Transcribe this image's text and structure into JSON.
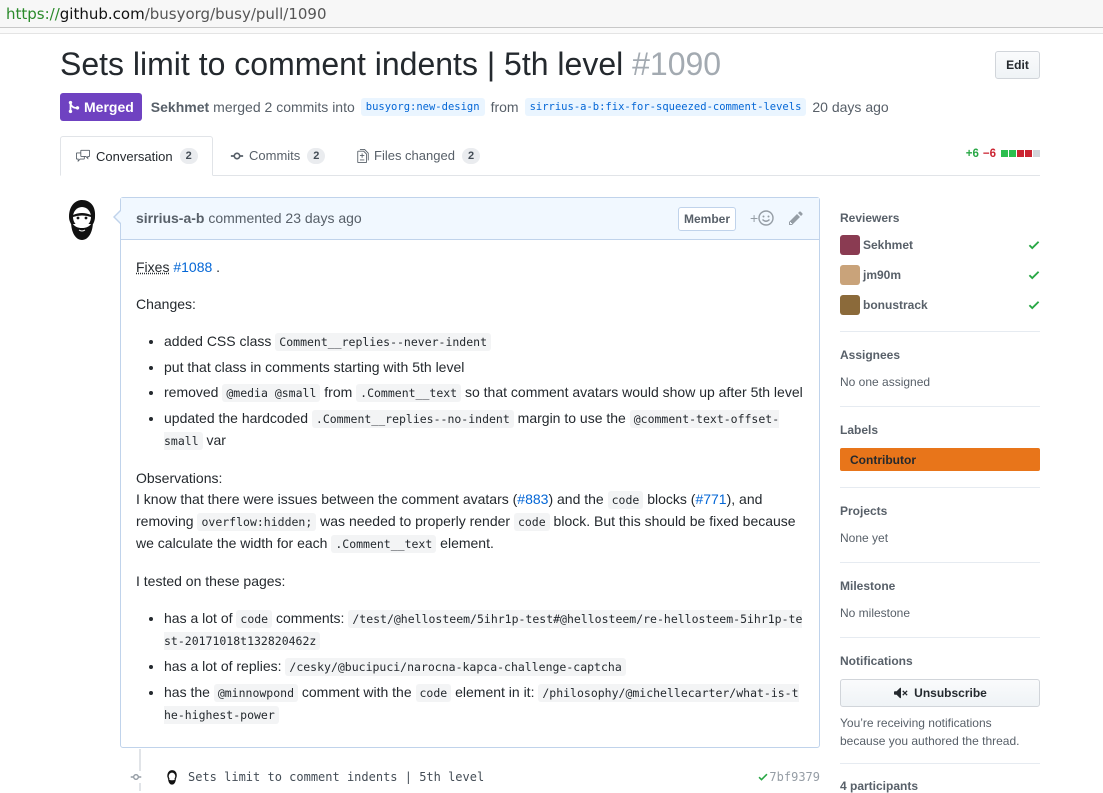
{
  "browser": {
    "url_scheme": "https://",
    "url_host": "github.com",
    "url_path": "/busyorg/busy/pull/1090"
  },
  "pr": {
    "title": "Sets limit to comment indents | 5th level",
    "number": "#1090",
    "edit_label": "Edit",
    "state": "Merged",
    "merged_by": "Sekhmet",
    "merge_text": "merged 2 commits into",
    "base_branch": "busyorg:new-design",
    "from_text": "from",
    "head_branch": "sirrius-a-b:fix-for-squeezed-comment-levels",
    "time": "20 days ago"
  },
  "tabs": [
    {
      "label": "Conversation",
      "count": "2"
    },
    {
      "label": "Commits",
      "count": "2"
    },
    {
      "label": "Files changed",
      "count": "2"
    }
  ],
  "diffstat": {
    "additions": "+6",
    "deletions": "−6",
    "colors": [
      "#2cbe4e",
      "#2cbe4e",
      "#cb2431",
      "#cb2431",
      "#d1d5da"
    ]
  },
  "comment": {
    "author": "sirrius-a-b",
    "action": "commented",
    "time": "23 days ago",
    "role": "Member",
    "reaction_plus": "+"
  },
  "body": {
    "fixes_prefix": "Fixes",
    "fixes_link": "#1088",
    "fixes_suffix": ".",
    "changes_heading": "Changes:",
    "c1_text": "added CSS class",
    "c1_code": "Comment__replies--never-indent",
    "c2_text": "put that class in comments starting with 5th level",
    "c3_a": "removed",
    "c3_code1": "@media @small",
    "c3_b": "from",
    "c3_code2": ".Comment__text",
    "c3_c": "so that comment avatars would show up after 5th level",
    "c4_a": "updated the hardcoded",
    "c4_code1": ".Comment__replies--no-indent",
    "c4_b": "margin to use the",
    "c4_code2": "@comment-text-offset-small",
    "c4_c": "var",
    "obs_heading": "Observations:",
    "obs_a": "I know that there were issues between the comment avatars (",
    "obs_link1": "#883",
    "obs_b": ") and the",
    "obs_code1": "code",
    "obs_c": "blocks (",
    "obs_link2": "#771",
    "obs_d": "), and removing",
    "obs_code2": "overflow:hidden;",
    "obs_e": "was needed to properly render",
    "obs_code3": "code",
    "obs_f": "block. But this should be fixed because we calculate the width for each",
    "obs_code4": ".Comment__text",
    "obs_g": "element.",
    "tested_heading": "I tested on these pages:",
    "t1_a": "has a lot of",
    "t1_code1": "code",
    "t1_b": "comments:",
    "t1_code2": "/test/@hellosteem/5ihr1p-test#@hellosteem/re-hellosteem-5ihr1p-test-20171018t132820462z",
    "t2_a": "has a lot of replies:",
    "t2_code": "/cesky/@bucipuci/narocna-kapca-challenge-captcha",
    "t3_a": "has the",
    "t3_code1": "@minnowpond",
    "t3_b": "comment with the",
    "t3_code2": "code",
    "t3_c": "element in it:",
    "t3_code3": "/philosophy/@michellecarter/what-is-the-highest-power"
  },
  "commit": {
    "message": "Sets limit to comment indents | 5th level",
    "sha": "7bf9379"
  },
  "sidebar": {
    "reviewers_heading": "Reviewers",
    "reviewers": [
      {
        "name": "Sekhmet",
        "color": "#8a3b52"
      },
      {
        "name": "jm90m",
        "color": "#c9a37a"
      },
      {
        "name": "bonustrack",
        "color": "#8b6a3a"
      }
    ],
    "assignees_heading": "Assignees",
    "assignees_value": "No one assigned",
    "labels_heading": "Labels",
    "label": "Contributor",
    "projects_heading": "Projects",
    "projects_value": "None yet",
    "milestone_heading": "Milestone",
    "milestone_value": "No milestone",
    "notifications_heading": "Notifications",
    "unsubscribe_label": "Unsubscribe",
    "notify_line1": "You’re receiving notifications",
    "notify_line2": "because you authored the thread.",
    "participants": "4 participants"
  }
}
